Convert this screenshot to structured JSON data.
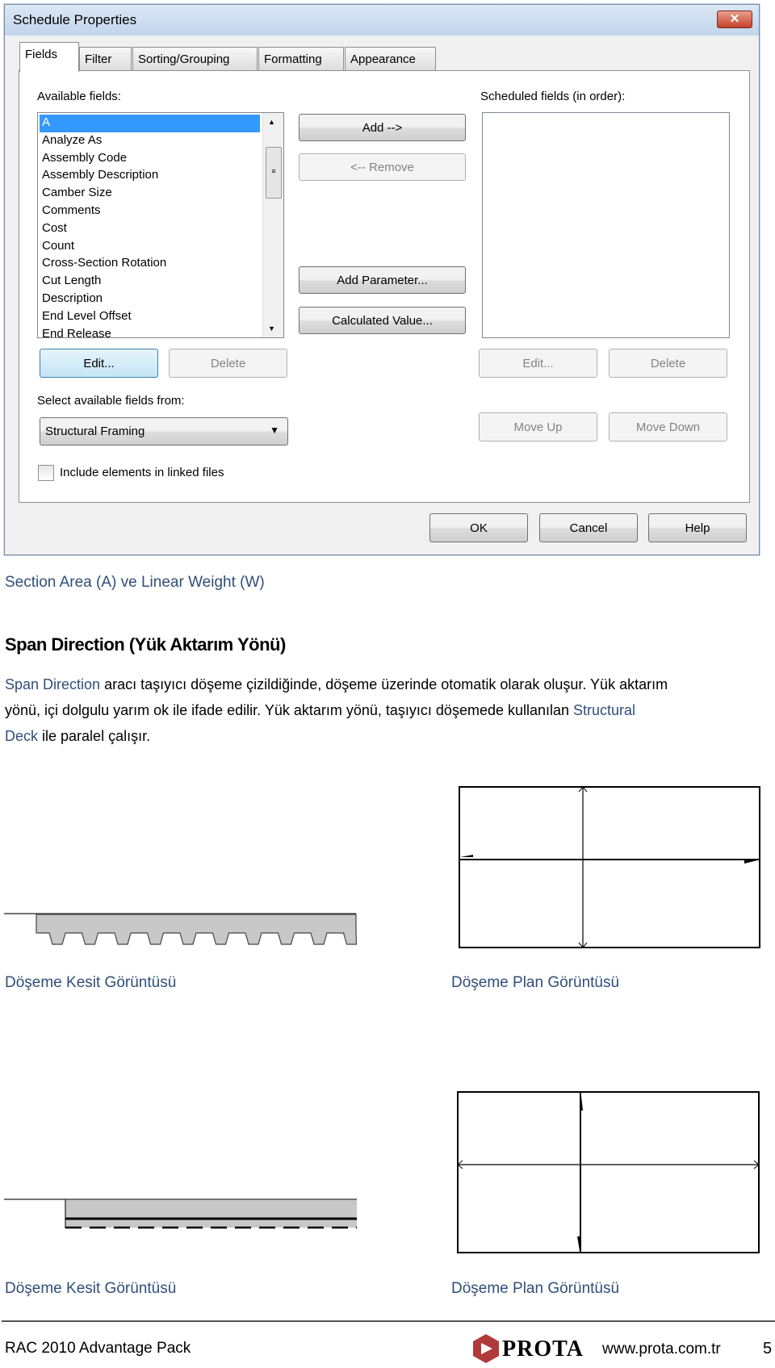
{
  "dialog": {
    "title": "Schedule Properties",
    "close_icon": "close-x-icon",
    "tabs": [
      {
        "label": "Fields",
        "active": true
      },
      {
        "label": "Filter"
      },
      {
        "label": "Sorting/Grouping"
      },
      {
        "label": "Formatting"
      },
      {
        "label": "Appearance"
      }
    ],
    "available_label": "Available fields:",
    "available_fields": [
      "A",
      "Analyze As",
      "Assembly Code",
      "Assembly Description",
      "Camber Size",
      "Comments",
      "Cost",
      "Count",
      "Cross-Section Rotation",
      "Cut Length",
      "Description",
      "End Level Offset",
      "End Release"
    ],
    "selected_field": "A",
    "scheduled_label": "Scheduled fields (in order):",
    "add": "Add -->",
    "remove": "<-- Remove",
    "add_parameter": "Add Parameter...",
    "calculated_value": "Calculated Value...",
    "edit": "Edit...",
    "delete": "Delete",
    "edit2": "Edit...",
    "delete2": "Delete",
    "select_from_label": "Select available fields from:",
    "select_from_value": "Structural Framing",
    "move_up": "Move Up",
    "move_down": "Move Down",
    "include_linked": "Include elements in linked files",
    "include_linked_checked": false,
    "ok": "OK",
    "cancel": "Cancel",
    "help": "Help"
  },
  "doc": {
    "subtitle": "Section Area (A) ve Linear Weight (W)",
    "heading": "Span Direction (Yük Aktarım Yönü)",
    "para": {
      "l1_link": "Span Direction",
      "l1_text": " aracı taşıyıcı döşeme çizildiğinde, döşeme üzerinde otomatik olarak oluşur. Yük aktarım",
      "l2_text": "yönü, içi dolgulu yarım ok ile ifade edilir. Yük aktarım yönü, taşıyıcı döşemede kullanılan ",
      "l2_link": "Structural",
      "l3_link": "Deck",
      "l3_text": " ile paralel çalışır."
    },
    "captions": {
      "section1": "Döşeme Kesit Görüntüsü",
      "plan1": "Döşeme Plan Görüntüsü",
      "section2": "Döşeme Kesit Görüntüsü",
      "plan2": "Döşeme Plan Görüntüsü"
    }
  },
  "footer": {
    "left": "RAC 2010 Advantage Pack",
    "logo": "PROTA",
    "url": "www.prota.com.tr",
    "page": "5"
  },
  "colors": {
    "link": "#2f4f7a",
    "selection": "#3399ff"
  }
}
